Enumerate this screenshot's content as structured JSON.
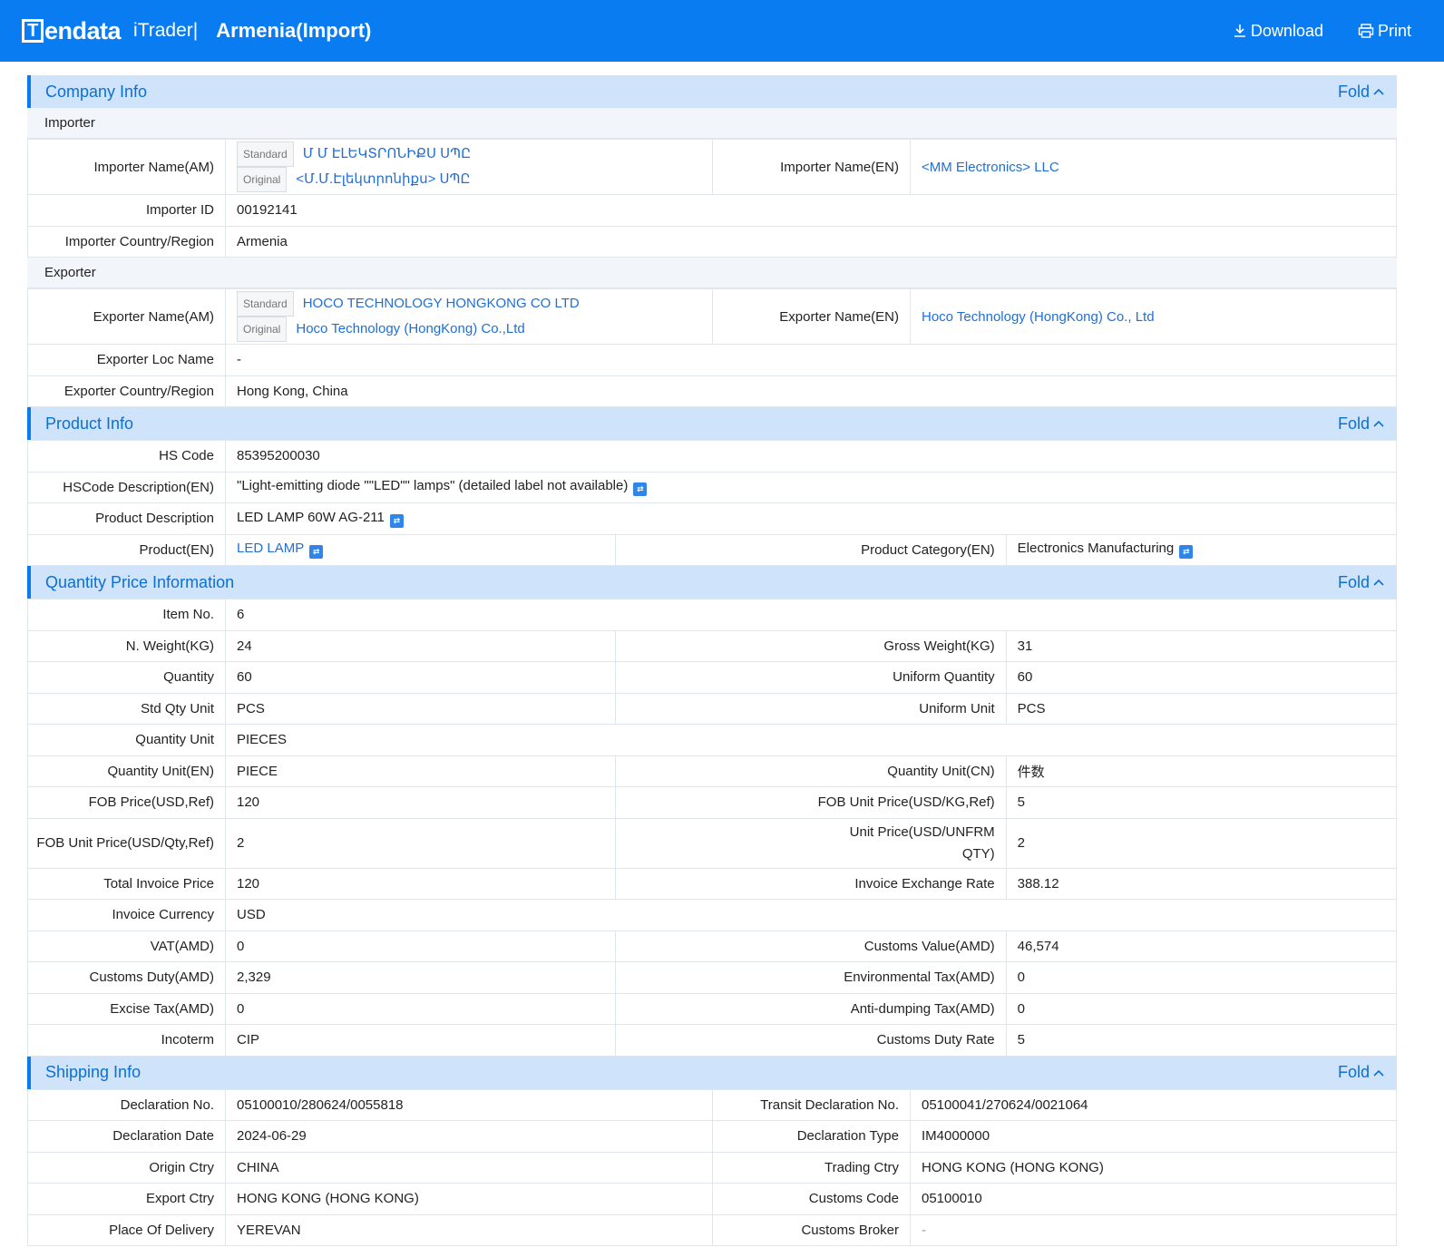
{
  "header": {
    "logo_text": "endata",
    "logo_letter": "T",
    "product": "iTrader|",
    "title": "Armenia(Import)",
    "download": "Download",
    "print": "Print"
  },
  "fold_label": "Fold",
  "company": {
    "title": "Company Info",
    "importer_head": "Importer",
    "importer_name_am_label": "Importer Name(AM)",
    "tag_standard": "Standard",
    "tag_original": "Original",
    "importer_name_am_standard": "Մ Մ ԷԼԵԿՏՐՈՆԻՔՍ ՍՊԸ",
    "importer_name_am_original": "<Մ.Մ.Էլեկտրոնիքս> ՍՊԸ",
    "importer_name_en_label": "Importer Name(EN)",
    "importer_name_en": "<MM Electronics> LLC",
    "importer_id_label": "Importer ID",
    "importer_id": "00192141",
    "importer_country_label": "Importer Country/Region",
    "importer_country": "Armenia",
    "exporter_head": "Exporter",
    "exporter_name_am_label": "Exporter Name(AM)",
    "exporter_name_am_standard": "HOCO TECHNOLOGY HONGKONG CO LTD",
    "exporter_name_am_original": "Hoco Technology (HongKong) Co.,Ltd",
    "exporter_name_en_label": "Exporter Name(EN)",
    "exporter_name_en": "Hoco Technology (HongKong) Co., Ltd",
    "exporter_loc_label": "Exporter Loc Name",
    "exporter_loc": "-",
    "exporter_country_label": "Exporter Country/Region",
    "exporter_country": "Hong Kong, China"
  },
  "product": {
    "title": "Product Info",
    "hs_code_label": "HS Code",
    "hs_code": "85395200030",
    "hs_desc_label": "HSCode Description(EN)",
    "hs_desc": "\"Light-emitting diode \"\"LED\"\" lamps\" (detailed label not available)",
    "prod_desc_label": "Product Description",
    "prod_desc": "LED LAMP 60W AG-211",
    "product_en_label": "Product(EN)",
    "product_en": "LED LAMP",
    "category_label": "Product Category(EN)",
    "category": "Electronics Manufacturing"
  },
  "quantity": {
    "title": "Quantity Price Information",
    "rows": {
      "item_no_label": "Item No.",
      "item_no": "6",
      "nweight_label": "N. Weight(KG)",
      "nweight": "24",
      "gweight_label": "Gross Weight(KG)",
      "gweight": "31",
      "qty_label": "Quantity",
      "qty": "60",
      "uqty_label": "Uniform Quantity",
      "uqty": "60",
      "stdunit_label": "Std Qty Unit",
      "stdunit": "PCS",
      "uunit_label": "Uniform Unit",
      "uunit": "PCS",
      "qunit_label": "Quantity Unit",
      "qunit": "PIECES",
      "qunit_en_label": "Quantity Unit(EN)",
      "qunit_en": "PIECE",
      "qunit_cn_label": "Quantity Unit(CN)",
      "qunit_cn": "件数",
      "fob_label": "FOB Price(USD,Ref)",
      "fob": "120",
      "fob_kg_label": "FOB Unit Price(USD/KG,Ref)",
      "fob_kg": "5",
      "fob_qty_label": "FOB Unit Price(USD/Qty,Ref)",
      "fob_qty": "2",
      "unit_unfrm_label_1": "Unit Price(USD/UNFRM",
      "unit_unfrm_label_2": "QTY)",
      "unit_unfrm": "2",
      "total_inv_label": "Total Invoice Price",
      "total_inv": "120",
      "inv_rate_label": "Invoice Exchange Rate",
      "inv_rate": "388.12",
      "inv_cur_label": "Invoice Currency",
      "inv_cur": "USD",
      "vat_label": "VAT(AMD)",
      "vat": "0",
      "cust_val_label": "Customs Value(AMD)",
      "cust_val": "46,574",
      "duty_label": "Customs Duty(AMD)",
      "duty": "2,329",
      "env_label": "Environmental Tax(AMD)",
      "env": "0",
      "excise_label": "Excise Tax(AMD)",
      "excise": "0",
      "antidump_label": "Anti-dumping Tax(AMD)",
      "antidump": "0",
      "incoterm_label": "Incoterm",
      "incoterm": "CIP",
      "duty_rate_label": "Customs Duty Rate",
      "duty_rate": "5"
    }
  },
  "shipping": {
    "title": "Shipping Info",
    "decl_no_label": "Declaration No.",
    "decl_no": "05100010/280624/0055818",
    "transit_label": "Transit Declaration No.",
    "transit": "05100041/270624/0021064",
    "decl_date_label": "Declaration Date",
    "decl_date": "2024-06-29",
    "decl_type_label": "Declaration Type",
    "decl_type": "IM4000000",
    "origin_label": "Origin Ctry",
    "origin": "CHINA",
    "trading_label": "Trading Ctry",
    "trading": "HONG KONG (HONG KONG)",
    "export_label": "Export Ctry",
    "export": "HONG KONG (HONG KONG)",
    "cust_code_label": "Customs Code",
    "cust_code": "05100010",
    "delivery_label": "Place Of Delivery",
    "delivery": "YEREVAN",
    "broker_label": "Customs Broker",
    "broker": "-"
  }
}
